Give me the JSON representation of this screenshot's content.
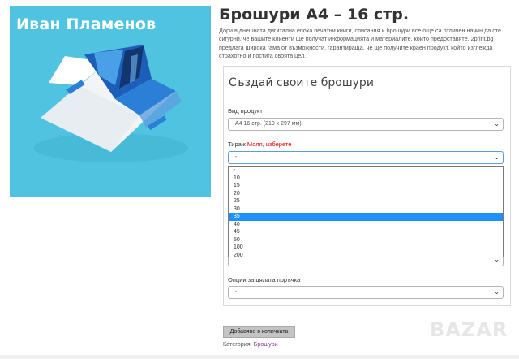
{
  "watermark": {
    "name": "Иван Пламенов"
  },
  "product": {
    "title": "Брошури А4 – 16 стр.",
    "description": "Дори в днешната дигитална епоха печатни книги, списания и брошури все още са отличен начин да сте сигурни, че вашите клиенти ще получат информацията и материалите, които предоставяте. 2print.bg предлага широка гама от възможности, гарантираща, че ще получите краен продукт, който изглежда страхотно и постига своята цел."
  },
  "form": {
    "heading": "Създай своите брошури",
    "product_type": {
      "label": "Вид продукт",
      "value": "А4 16 стр. (210 x 297 мм)"
    },
    "quantity": {
      "label": "Тираж",
      "required_note": "Моля, изберете",
      "value": "-",
      "options": [
        "-",
        "10",
        "15",
        "20",
        "25",
        "30",
        "35",
        "40",
        "45",
        "50",
        "100",
        "200"
      ],
      "highlighted_option": "35"
    },
    "order_options": {
      "label": "Опции за цялата поръчка",
      "value": "-"
    }
  },
  "add_button_label": "Добавяне в количката",
  "category": {
    "label": "Категория:",
    "link": "Брошури"
  },
  "colors": {
    "highlight": "#1e90ff",
    "required": "#e00000",
    "image_background": "#4fc3e0"
  },
  "icons": {
    "select_arrow": "chevron-down-icon"
  }
}
